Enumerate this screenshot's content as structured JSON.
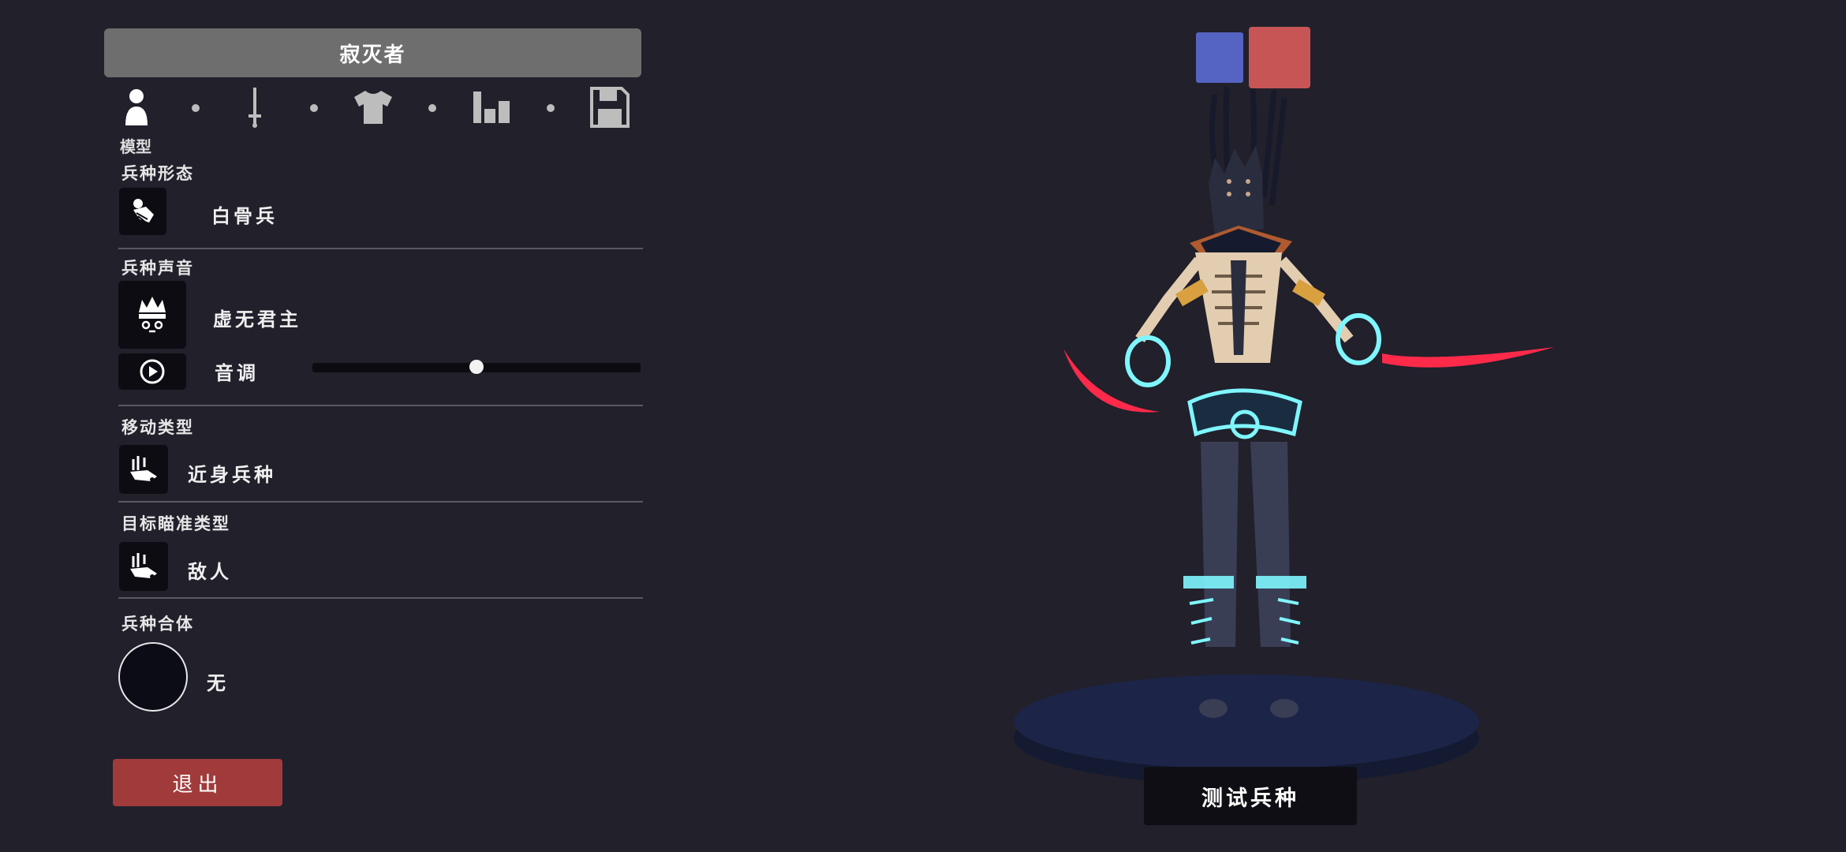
{
  "unit_name": "寂灭者",
  "tabs": [
    {
      "icon": "person-icon",
      "label": "模型",
      "active": true
    },
    {
      "icon": "sword-icon",
      "label": "",
      "active": false
    },
    {
      "icon": "shirt-icon",
      "label": "",
      "active": false
    },
    {
      "icon": "bar-chart-icon",
      "label": "",
      "active": false
    },
    {
      "icon": "save-icon",
      "label": "",
      "active": false
    }
  ],
  "active_tab_label": "模型",
  "sections": {
    "form": {
      "title": "兵种形态",
      "value": "白骨兵",
      "icon": "skeleton-icon"
    },
    "voice": {
      "title": "兵种声音",
      "value": "虚无君主",
      "icon": "crown-mask-icon",
      "pitch_label": "音调",
      "pitch_level": 0.5
    },
    "movement": {
      "title": "移动类型",
      "value": "近身兵种",
      "icon": "melee-unit-icon"
    },
    "target": {
      "title": "目标瞄准类型",
      "value": "敌人",
      "icon": "target-unit-icon"
    },
    "merge": {
      "title": "兵种合体",
      "value": "无"
    }
  },
  "buttons": {
    "exit": "退出",
    "test": "测试兵种"
  },
  "colors": {
    "background": "#21202b",
    "title_bar": "#6e6e6e",
    "exit": "#a13b3b",
    "team_blue": "#5563c2",
    "team_red": "#c85556",
    "glow": "#7ff6ff",
    "blade": "#ff2a4a"
  }
}
